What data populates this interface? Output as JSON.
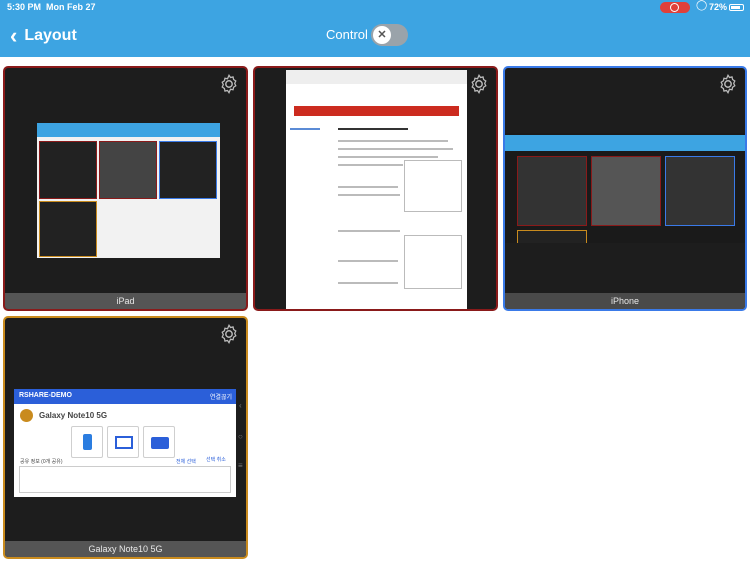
{
  "status_bar": {
    "time": "5:30 PM",
    "date": "Mon Feb 27",
    "battery": "72%"
  },
  "nav": {
    "back_label": "Layout",
    "control_label": "Control",
    "toggle_on": false
  },
  "tiles": [
    {
      "name": "iPad",
      "border": "#8a1a1a"
    },
    {
      "name": "",
      "border": "#8a1a1a"
    },
    {
      "name": "iPhone",
      "border": "#3a7ae8"
    },
    {
      "name": "Galaxy Note10 5G",
      "border": "#c98b1e"
    }
  ],
  "galaxy": {
    "app_title": "RSHARE-DEMO",
    "device": "Galaxy Note10 5G",
    "share_info": "공유 정보 (0개 공유)",
    "disconnect": "연결끊기",
    "btn_select_all": "전체 선택",
    "btn_deselect": "선택 취소"
  },
  "colors": {
    "accent": "#3da4e2",
    "galaxy_header": "#2b5fd9"
  }
}
